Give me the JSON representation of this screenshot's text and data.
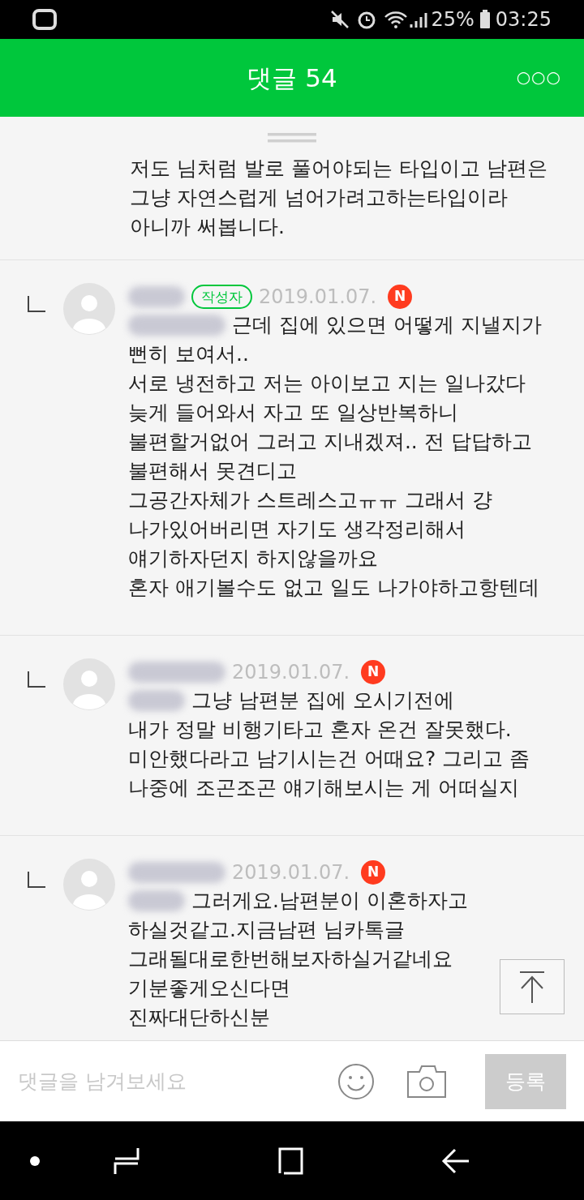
{
  "status_bar": {
    "battery": "25%",
    "time": "03:25"
  },
  "header": {
    "title": "댓글 54",
    "more": "○○○"
  },
  "top_comment": {
    "lines": [
      "저도 님처럼 발로 풀어야되는 타입이고 남편은",
      "그냥 자연스럽게 넘어가려고하는타입이라",
      "아니까 써봅니다."
    ]
  },
  "replies": [
    {
      "author_badge": "작성자",
      "date": "2019.01.07.",
      "new_badge": "N",
      "lines": [
        "근데 집에 있으면 어떻게 지낼지가",
        "뻔히 보여서..",
        "서로 냉전하고 저는 아이보고 지는 일나갔다",
        "늦게 들어와서 자고 또 일상반복하니",
        "불편할거없어 그러고 지내겠져.. 전 답답하고",
        "불편해서 못견디고",
        "그공간자체가 스트레스고ㅠㅠ 그래서 걍",
        "나가있어버리면 자기도 생각정리해서",
        "얘기하자던지 하지않을까요",
        "혼자 애기볼수도 없고 일도 나가야하고항텐데"
      ]
    },
    {
      "date": "2019.01.07.",
      "new_badge": "N",
      "lines": [
        "그냥 남편분 집에 오시기전에",
        "내가 정말 비행기타고 혼자 온건 잘못했다.",
        "미안했다라고 남기시는건 어때요? 그리고 좀",
        "나중에 조곤조곤 얘기해보시는 게 어떠실지"
      ]
    },
    {
      "date": "2019.01.07.",
      "new_badge": "N",
      "lines": [
        "그러게요.남편분이 이혼하자고",
        "하실것같고.지금남편 님카톡글",
        "그래될대로한번해보자하실거같네요",
        "기분좋게오신다면",
        "진짜대단하신분"
      ]
    }
  ],
  "input_bar": {
    "placeholder": "댓글을 남겨보세요",
    "submit": "등록"
  }
}
